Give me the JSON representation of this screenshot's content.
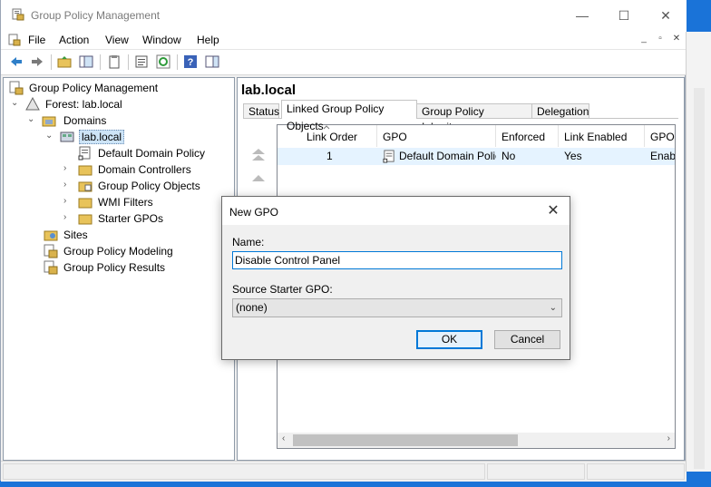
{
  "window": {
    "title": "Group Policy Management",
    "minimize": "—",
    "maximize": "☐",
    "close": "✕"
  },
  "menu": {
    "items": [
      "File",
      "Action",
      "View",
      "Window",
      "Help"
    ],
    "sys": [
      "_",
      "▫",
      "✕"
    ]
  },
  "tree": {
    "root": "Group Policy Management",
    "forest": "Forest: lab.local",
    "domains": "Domains",
    "domain": "lab.local",
    "ddp": "Default Domain Policy",
    "dc": "Domain Controllers",
    "gpo": "Group Policy Objects",
    "wmi": "WMI Filters",
    "starter": "Starter GPOs",
    "sites": "Sites",
    "modeling": "Group Policy Modeling",
    "results": "Group Policy Results"
  },
  "right": {
    "heading": "lab.local",
    "tabs": [
      "Status",
      "Linked Group Policy Objects",
      "Group Policy Inheritance",
      "Delegation"
    ],
    "columns": [
      "Link Order",
      "GPO",
      "Enforced",
      "Link Enabled",
      "GPO"
    ],
    "rows": [
      {
        "order": "1",
        "gpo": "Default Domain Policy",
        "enforced": "No",
        "enabled": "Yes",
        "status": "Enab"
      }
    ]
  },
  "dialog": {
    "title": "New GPO",
    "name_label": "Name:",
    "name_value": "Disable Control Panel",
    "source_label": "Source Starter GPO:",
    "source_value": "(none)",
    "ok": "OK",
    "cancel": "Cancel"
  }
}
